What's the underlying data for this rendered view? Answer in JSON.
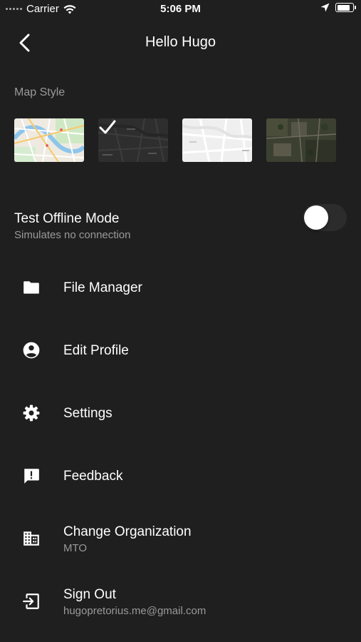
{
  "status_bar": {
    "carrier": "Carrier",
    "time": "5:06 PM",
    "battery_level": 0.85,
    "icons": [
      "signal-dots-icon",
      "wifi-icon",
      "location-arrow-icon",
      "battery-icon"
    ]
  },
  "header": {
    "title": "Hello Hugo",
    "back_icon": "chevron-left-icon"
  },
  "map_style": {
    "label": "Map Style",
    "options": [
      {
        "name": "streets",
        "selected": false
      },
      {
        "name": "dark",
        "selected": true
      },
      {
        "name": "light",
        "selected": false
      },
      {
        "name": "satellite",
        "selected": false
      }
    ]
  },
  "offline_mode": {
    "title": "Test Offline Mode",
    "subtitle": "Simulates no connection",
    "enabled": false
  },
  "menu": {
    "items": [
      {
        "label": "File Manager",
        "subtitle": "",
        "icon": "folder-icon"
      },
      {
        "label": "Edit Profile",
        "subtitle": "",
        "icon": "account-circle-icon"
      },
      {
        "label": "Settings",
        "subtitle": "",
        "icon": "gear-icon"
      },
      {
        "label": "Feedback",
        "subtitle": "",
        "icon": "feedback-icon"
      },
      {
        "label": "Change Organization",
        "subtitle": "MTO",
        "icon": "building-icon"
      },
      {
        "label": "Sign Out",
        "subtitle": "hugopretorius.me@gmail.com",
        "icon": "sign-out-icon"
      }
    ]
  },
  "colors": {
    "background": "#1f1f1f",
    "text_primary": "#ffffff",
    "text_secondary": "#9a9a9a"
  }
}
